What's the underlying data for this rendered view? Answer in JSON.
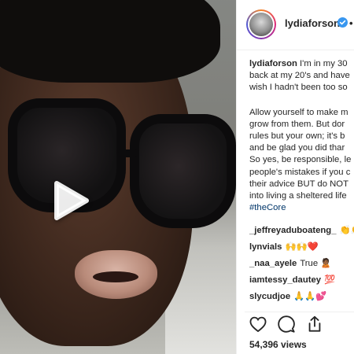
{
  "post": {
    "username": "lydiaforson",
    "more_dot": "•"
  },
  "caption": {
    "lines": [
      {
        "prefix_bold": "lydiaforson",
        "text": " I'm in my 30"
      },
      {
        "text": "back at my 20's and have"
      },
      {
        "text": "wish I hadn't been too so"
      },
      {
        "gap": true
      },
      {
        "text": "Allow yourself to make m"
      },
      {
        "text": "grow from them. But dor"
      },
      {
        "text": "rules but your own; it's b"
      },
      {
        "text": "and be glad you did thar"
      },
      {
        "text": "So yes, be responsible, le"
      },
      {
        "text": "people's mistakes if you c"
      },
      {
        "text": "their advice BUT do NOT"
      },
      {
        "text": "into living a sheltered life"
      },
      {
        "tag": "#theCore"
      }
    ]
  },
  "comments": [
    {
      "user": "_jeffreyaduboateng_",
      "text": "👏👏"
    },
    {
      "user": "lynvials",
      "text": "🙌🙌❤️"
    },
    {
      "user": "_naa_ayele",
      "text": "True 🙎🏾"
    },
    {
      "user": "iamtessy_dautey",
      "text": "💯"
    },
    {
      "user": "slycudjoe",
      "text": "🙏🙏💕"
    }
  ],
  "actions": {
    "like_icon": "heart-icon",
    "comment_icon": "comment-icon",
    "share_icon": "share-icon"
  },
  "stats": {
    "views": "54,396 views"
  },
  "video": {
    "play_icon": "play-icon"
  },
  "colors": {
    "text": "#262626",
    "hashtag": "#003569",
    "verified": "#3897f0"
  }
}
